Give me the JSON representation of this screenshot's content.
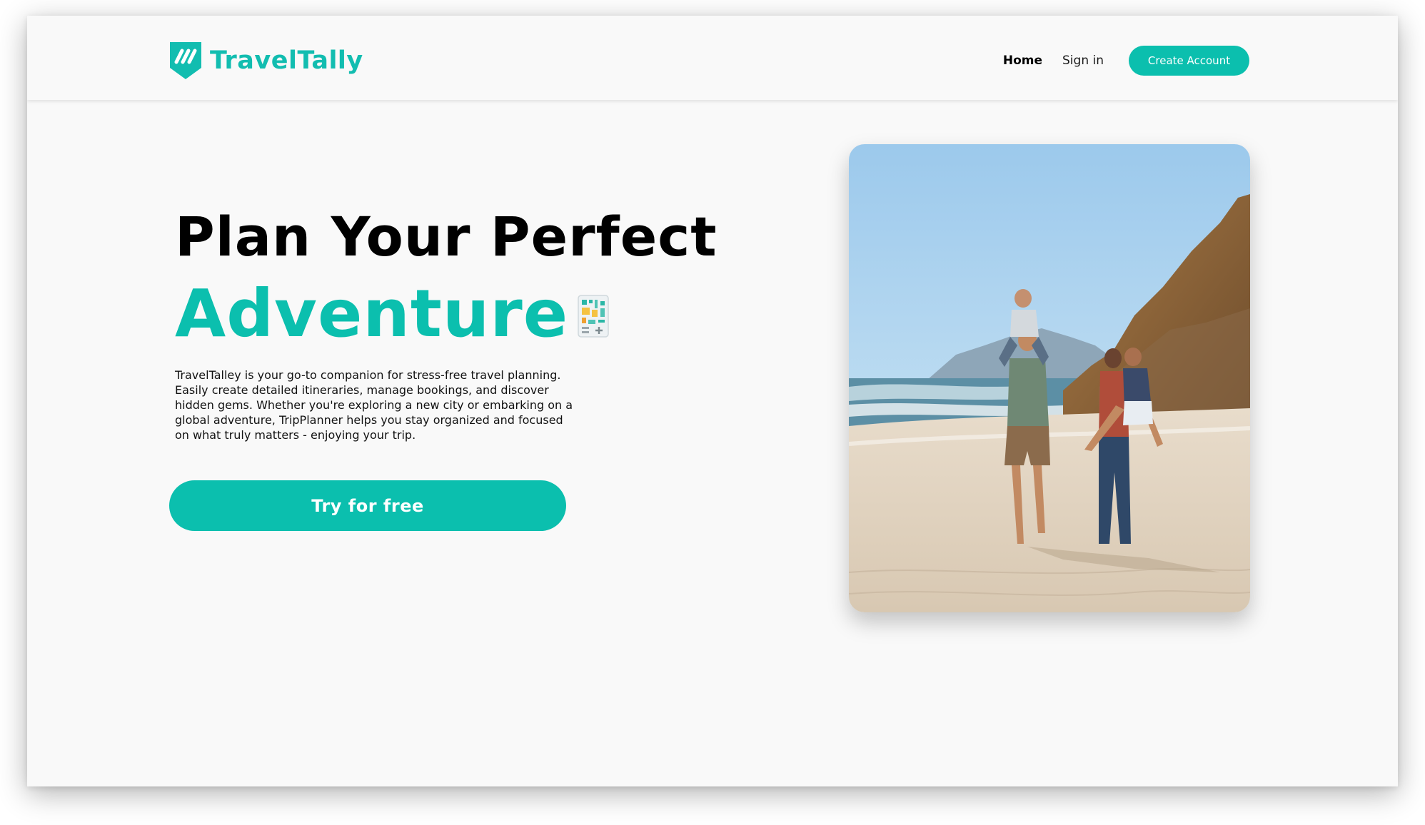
{
  "header": {
    "brand": "TravelTally",
    "nav": {
      "home": "Home",
      "sign_in": "Sign in",
      "create_account": "Create Account"
    }
  },
  "hero": {
    "title_line1": "Plan Your Perfect",
    "title_line2": "Adventure",
    "description": "TravelTalley is your go-to companion for stress-free travel planning. Easily create detailed itineraries, manage bookings, and discover hidden gems. Whether you're exploring a new city or embarking on a global adventure, TripPlanner helps you stay organized and focused on what truly matters - enjoying your trip.",
    "cta_label": "Try for free",
    "photo": "family-on-beach"
  },
  "colors": {
    "accent": "#0bbfae",
    "brand": "#12bdb0",
    "text": "#000000",
    "background": "#f9f9f9"
  },
  "icons": {
    "logo": "shield-logo-icon",
    "title_emoji": "itinerary-map-icon"
  }
}
